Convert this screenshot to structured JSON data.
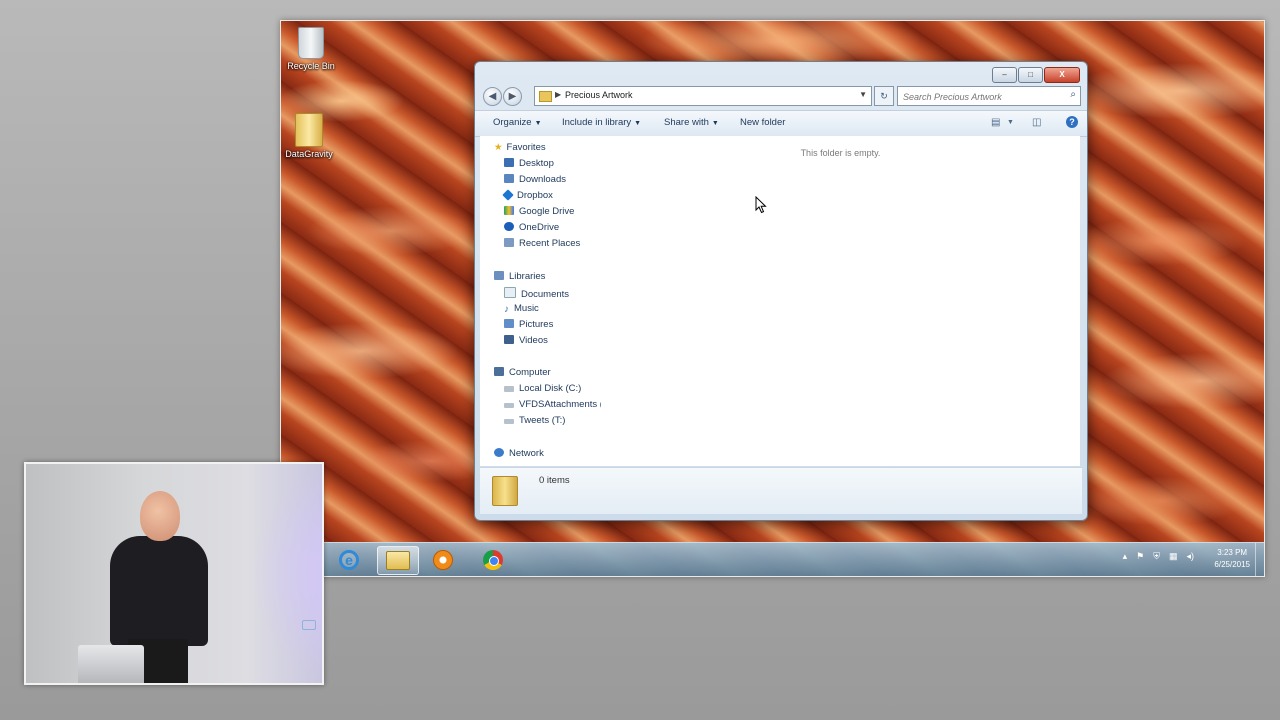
{
  "desktop": {
    "icons": [
      {
        "label": "Recycle Bin"
      },
      {
        "label": "DataGravity"
      }
    ]
  },
  "explorer": {
    "address": {
      "path": "Precious Artwork"
    },
    "search": {
      "placeholder": "Search Precious Artwork"
    },
    "caption": {
      "minimize": "–",
      "maximize": "□",
      "close": "X"
    },
    "toolbar": {
      "organize": "Organize",
      "include_in_library": "Include in library",
      "share_with": "Share with",
      "new_folder": "New folder"
    },
    "nav": {
      "favorites": {
        "label": "Favorites",
        "items": [
          "Desktop",
          "Downloads",
          "Dropbox",
          "Google Drive",
          "OneDrive",
          "Recent Places"
        ]
      },
      "libraries": {
        "label": "Libraries",
        "items": [
          "Documents",
          "Music",
          "Pictures",
          "Videos"
        ]
      },
      "computer": {
        "label": "Computer",
        "items": [
          "Local Disk (C:)",
          "VFDSAttachments (F",
          "Tweets (T:)"
        ]
      },
      "network": {
        "label": "Network"
      }
    },
    "content": {
      "empty_message": "This folder is empty."
    },
    "details": {
      "item_count": "0 items"
    }
  },
  "taskbar": {
    "apps": [
      "internet-explorer",
      "windows-explorer",
      "media-player",
      "google-chrome"
    ],
    "clock": {
      "time": "3:23 PM",
      "date": "6/25/2015"
    }
  },
  "colors": {
    "accent": "#2e6fc2",
    "link_text": "#1e395b"
  }
}
